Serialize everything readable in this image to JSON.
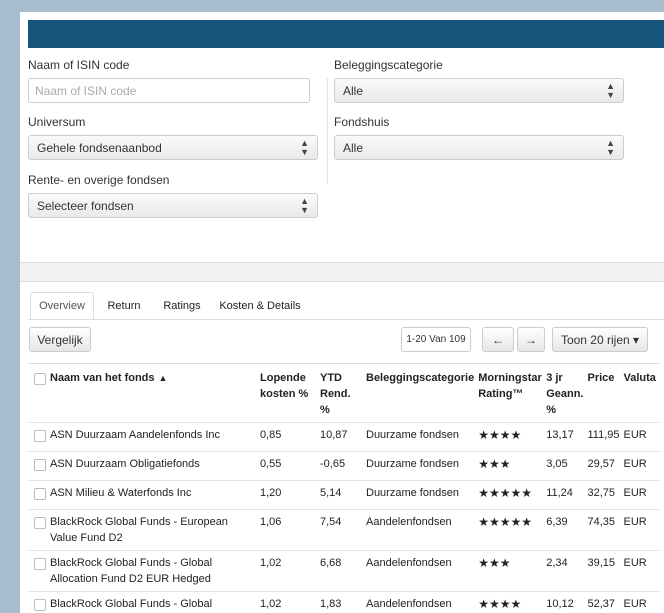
{
  "filters": {
    "isin_label": "Naam of ISIN code",
    "isin_placeholder": "Naam of ISIN code",
    "categorie_label": "Beleggingscategorie",
    "categorie_value": "Alle",
    "universum_label": "Universum",
    "universum_value": "Gehele fondsenaanbod",
    "fondshuis_label": "Fondshuis",
    "fondshuis_value": "Alle",
    "rente_label": "Rente- en overige fondsen",
    "rente_value": "Selecteer fondsen",
    "select_arrow_icon": "updown-icon"
  },
  "tabs": [
    "Overview",
    "Return",
    "Ratings",
    "Kosten & Details"
  ],
  "toolbar": {
    "vergelijk": "Vergelijk",
    "paging": "1-20 Van 109",
    "prev_icon": "←",
    "next_icon": "→",
    "rows_label": "Toon 20 rijen ▾"
  },
  "table": {
    "headers": {
      "name": "Naam van het fonds",
      "sort_icon": "▲",
      "lopende": "Lopende kosten %",
      "ytd": "YTD Rend. %",
      "cat": "Beleggingscategorie",
      "ms": "Morningstar Rating™",
      "jr3": "3 jr Geann. %",
      "price": "Price",
      "valuta": "Valuta"
    },
    "rows": [
      {
        "name": "ASN Duurzaam Aandelenfonds Inc",
        "kosten": "0,85",
        "ytd": "10,87",
        "cat": "Duurzame fondsen",
        "stars": "★★★★",
        "jr3": "13,17",
        "price": "111,95",
        "valuta": "EUR"
      },
      {
        "name": "ASN Duurzaam Obligatiefonds",
        "kosten": "0,55",
        "ytd": "-0,65",
        "cat": "Duurzame fondsen",
        "stars": "★★★",
        "jr3": "3,05",
        "price": "29,57",
        "valuta": "EUR"
      },
      {
        "name": "ASN Milieu & Waterfonds Inc",
        "kosten": "1,20",
        "ytd": "5,14",
        "cat": "Duurzame fondsen",
        "stars": "★★★★★",
        "jr3": "11,24",
        "price": "32,75",
        "valuta": "EUR"
      },
      {
        "name": "BlackRock Global Funds - European Value Fund D2",
        "kosten": "1,06",
        "ytd": "7,54",
        "cat": "Aandelenfondsen",
        "stars": "★★★★★",
        "jr3": "6,39",
        "price": "74,35",
        "valuta": "EUR"
      },
      {
        "name": "BlackRock Global Funds - Global Allocation Fund D2 EUR Hedged",
        "kosten": "1,02",
        "ytd": "6,68",
        "cat": "Aandelenfondsen",
        "stars": "★★★",
        "jr3": "2,34",
        "price": "39,15",
        "valuta": "EUR"
      },
      {
        "name": "BlackRock Global Funds - Global",
        "kosten": "1,02",
        "ytd": "1,83",
        "cat": "Aandelenfondsen",
        "stars": "★★★★",
        "jr3": "10,12",
        "price": "52,37",
        "valuta": "EUR"
      }
    ]
  }
}
